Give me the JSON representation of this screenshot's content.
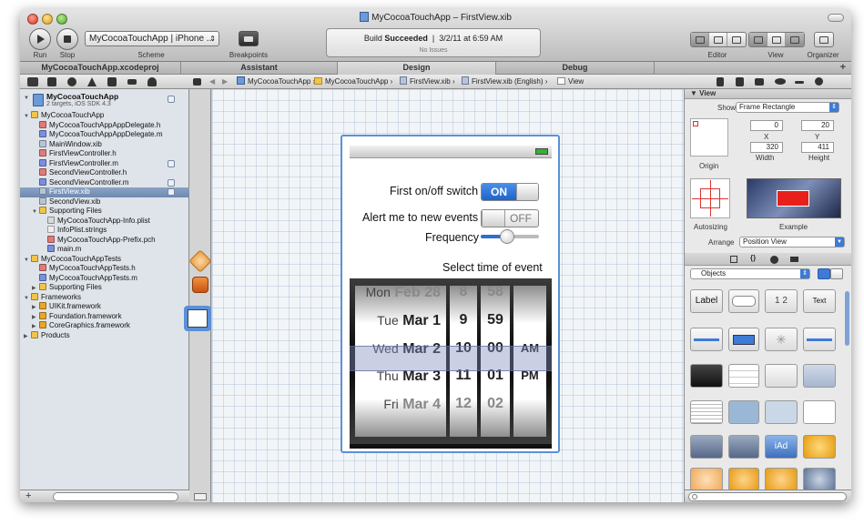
{
  "window": {
    "title": "MyCocoaTouchApp – FirstView.xib"
  },
  "toolbar": {
    "scheme_value": "MyCocoaTouchApp | iPhone ...",
    "run_label": "Run",
    "stop_label": "Stop",
    "scheme_label": "Scheme",
    "breakpoints_label": "Breakpoints",
    "editor_label": "Editor",
    "view_label": "View",
    "organizer_label": "Organizer",
    "build_status_prefix": "Build",
    "build_status_state": "Succeeded",
    "build_status_time": "3/2/11 at 6:59 AM",
    "issues": "No Issues"
  },
  "tabs": {
    "project": "MyCocoaTouchApp.xcodeproj",
    "assistant": "Assistant",
    "design": "Design",
    "debug": "Debug"
  },
  "jumpbar": {
    "crumbs": [
      "MyCocoaTouchApp",
      "MyCocoaTouchApp",
      "FirstView.xib",
      "FirstView.xib (English)",
      "View"
    ]
  },
  "navigator": {
    "project_name": "MyCocoaTouchApp",
    "project_sub": "2 targets, iOS SDK 4.3",
    "items": [
      {
        "label": "MyCocoaTouchApp"
      },
      {
        "label": "MyCocoaTouchAppAppDelegate.h"
      },
      {
        "label": "MyCocoaTouchAppAppDelegate.m"
      },
      {
        "label": "MainWindow.xib"
      },
      {
        "label": "FirstViewController.h"
      },
      {
        "label": "FirstViewController.m"
      },
      {
        "label": "SecondViewController.h"
      },
      {
        "label": "SecondViewController.m"
      },
      {
        "label": "FirstView.xib"
      },
      {
        "label": "SecondView.xib"
      },
      {
        "label": "Supporting Files"
      },
      {
        "label": "MyCocoaTouchApp-Info.plist"
      },
      {
        "label": "InfoPlist.strings"
      },
      {
        "label": "MyCocoaTouchApp-Prefix.pch"
      },
      {
        "label": "main.m"
      },
      {
        "label": "MyCocoaTouchAppTests"
      },
      {
        "label": "MyCocoaTouchAppTests.h"
      },
      {
        "label": "MyCocoaTouchAppTests.m"
      },
      {
        "label": "Supporting Files"
      },
      {
        "label": "Frameworks"
      },
      {
        "label": "UIKit.framework"
      },
      {
        "label": "Foundation.framework"
      },
      {
        "label": "CoreGraphics.framework"
      },
      {
        "label": "Products"
      }
    ]
  },
  "canvas": {
    "switch1_label": "First on/off switch",
    "switch1_state": "ON",
    "switch2_label": "Alert me to new events",
    "switch2_state": "OFF",
    "slider_label": "Frequency",
    "slider_value": 0.45,
    "picker_title": "Select time of event",
    "picker": {
      "dates": [
        {
          "day": "Mon",
          "date": "Feb 28"
        },
        {
          "day": "Tue",
          "date": "Mar 1"
        },
        {
          "day": "Wed",
          "date": "Mar 2"
        },
        {
          "day": "Thu",
          "date": "Mar 3"
        },
        {
          "day": "Fri",
          "date": "Mar 4"
        }
      ],
      "hours": [
        "8",
        "9",
        "10",
        "11",
        "12"
      ],
      "minutes": [
        "58",
        "59",
        "00",
        "01",
        "02"
      ],
      "ampm": [
        "AM",
        "PM"
      ]
    }
  },
  "inspector": {
    "view_header": "View",
    "show_label": "Show",
    "show_value": "Frame Rectangle",
    "x_value": "0",
    "y_value": "20",
    "x_label": "X",
    "y_label": "Y",
    "width_value": "320",
    "height_value": "411",
    "width_label": "Width",
    "height_label": "Height",
    "origin_label": "Origin",
    "autosizing_label": "Autosizing",
    "example_label": "Example",
    "arrange_label": "Arrange",
    "arrange_value": "Position View",
    "library_select": "Objects",
    "lib_label": "Label",
    "lib_seg": "1  2",
    "lib_text": "Text",
    "lib_iad": "iAd"
  }
}
